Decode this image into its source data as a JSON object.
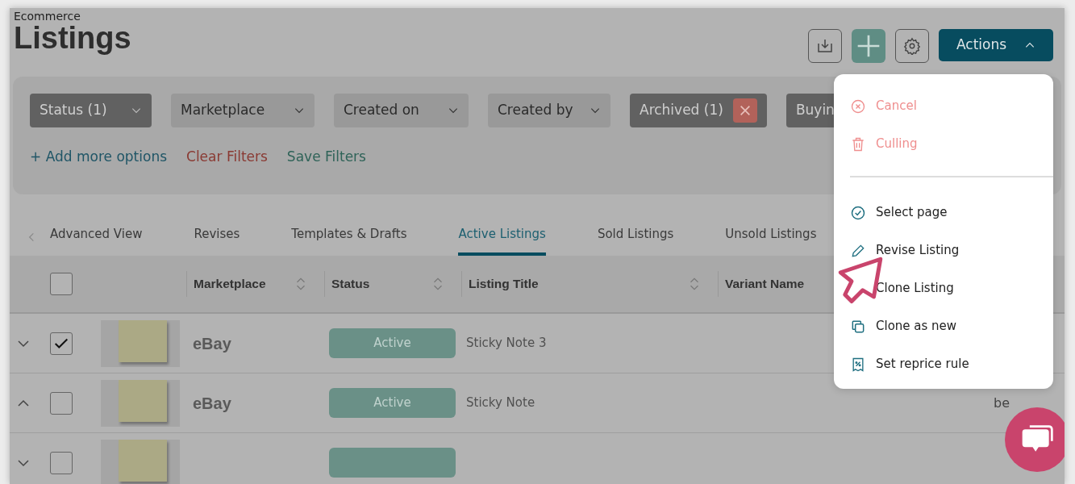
{
  "breadcrumb": "Ecommerce",
  "title": "Listings",
  "toolbar": {
    "actions_label": "Actions",
    "actions_expanded": true
  },
  "filters": [
    {
      "label": "Status (1)",
      "active": true,
      "kind": "dropdown"
    },
    {
      "label": "Marketplace",
      "active": false,
      "kind": "dropdown"
    },
    {
      "label": "Created on",
      "active": false,
      "kind": "dropdown"
    },
    {
      "label": "Created by",
      "active": false,
      "kind": "dropdown"
    },
    {
      "label": "Archived (1)",
      "active": true,
      "kind": "removable"
    },
    {
      "label": "Buyin",
      "active": true,
      "kind": "cut"
    }
  ],
  "filter_links": [
    {
      "label": "+ Add more options",
      "kind": "add"
    },
    {
      "label": "Clear Filters",
      "kind": "clear"
    },
    {
      "label": "Save Filters",
      "kind": "save"
    }
  ],
  "tabs": [
    {
      "label": "Advanced View",
      "selected": false
    },
    {
      "label": "Revises",
      "selected": false
    },
    {
      "label": "Templates & Drafts",
      "selected": false
    },
    {
      "label": "Active Listings",
      "selected": true
    },
    {
      "label": "Sold Listings",
      "selected": false
    },
    {
      "label": "Unsold Listings",
      "selected": false
    }
  ],
  "table": {
    "columns": [
      {
        "label": "Marketplace",
        "sortable": true
      },
      {
        "label": "Status",
        "sortable": true
      },
      {
        "label": "Listing Title",
        "sortable": true
      },
      {
        "label": "Variant Name",
        "sortable": false
      }
    ],
    "header_checked": false,
    "rows": [
      {
        "expanded": false,
        "checked": true,
        "marketplace": "eBay",
        "status": "Active",
        "title": "Sticky Note 3"
      },
      {
        "expanded": true,
        "checked": false,
        "marketplace": "eBay",
        "status": "Active",
        "title": "Sticky Note",
        "column_6": "be"
      },
      {
        "expanded": false,
        "checked": false
      }
    ]
  },
  "actions_menu": [
    {
      "label": "Cancel",
      "kind": "danger"
    },
    {
      "label": "Culling",
      "kind": "danger"
    },
    {
      "kind": "divider"
    },
    {
      "label": "Select page",
      "kind": "normal"
    },
    {
      "label": "Revise Listing",
      "kind": "normal"
    },
    {
      "label": "Clone Listing",
      "kind": "normal"
    },
    {
      "label": "Clone as new",
      "kind": "normal"
    },
    {
      "label": "Set reprice rule",
      "kind": "normal"
    }
  ]
}
